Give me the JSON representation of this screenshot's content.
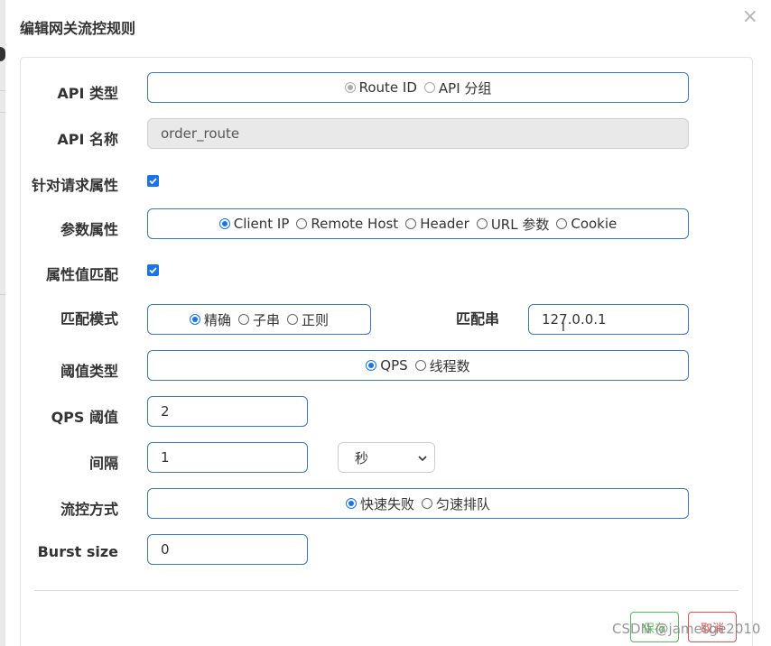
{
  "dialog": {
    "title": "编辑网关流控规则",
    "close_label": "×"
  },
  "form": {
    "api_type": {
      "label": "API 类型",
      "options": [
        "Route ID",
        "API 分组"
      ],
      "selected": "Route ID"
    },
    "api_name": {
      "label": "API 名称",
      "value": "order_route"
    },
    "request_attr": {
      "label": "针对请求属性",
      "checked": true
    },
    "param_attr": {
      "label": "参数属性",
      "options": [
        "Client IP",
        "Remote Host",
        "Header",
        "URL 参数",
        "Cookie"
      ],
      "selected": "Client IP"
    },
    "attr_match": {
      "label": "属性值匹配",
      "checked": true
    },
    "match_mode": {
      "label": "匹配模式",
      "options": [
        "精确",
        "子串",
        "正则"
      ],
      "selected": "精确"
    },
    "match_string": {
      "label": "匹配串",
      "value": "127.0.0.1"
    },
    "threshold_type": {
      "label": "阈值类型",
      "options": [
        "QPS",
        "线程数"
      ],
      "selected": "QPS"
    },
    "qps_threshold": {
      "label": "QPS 阈值",
      "value": "2"
    },
    "interval": {
      "label": "间隔",
      "value": "1",
      "unit": "秒"
    },
    "control_mode": {
      "label": "流控方式",
      "options": [
        "快速失败",
        "匀速排队"
      ],
      "selected": "快速失败"
    },
    "burst_size": {
      "label": "Burst size",
      "value": "0"
    }
  },
  "footer": {
    "save_label": "保存",
    "cancel_label": "取消"
  },
  "watermark": "CSDN @jamesge2010",
  "colors": {
    "accent": "#1a73e8",
    "field_border": "#3c78b5",
    "save": "#5cb85c",
    "cancel": "#d9534f"
  }
}
